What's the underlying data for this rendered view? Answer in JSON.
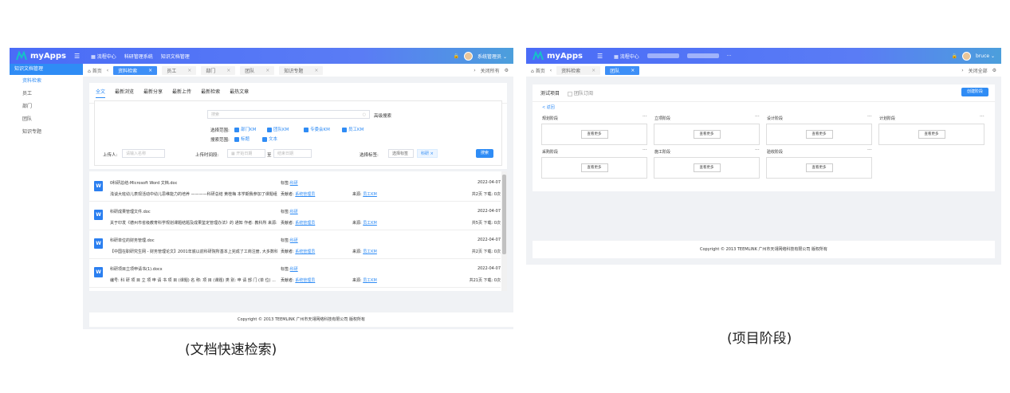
{
  "left": {
    "app_name": "myApps",
    "topnav": [
      "流程中心",
      "科研管理系统",
      "知识文档管理"
    ],
    "user": "系统管理员",
    "sidebar_title": "知识文档管理",
    "sidebar_items": [
      "资料检索",
      "员工",
      "部门",
      "团队",
      "知识专题"
    ],
    "tabs": [
      {
        "label": "首页"
      },
      {
        "label": "资料检索"
      },
      {
        "label": "员工"
      },
      {
        "label": "部门"
      },
      {
        "label": "团队"
      },
      {
        "label": "知识专题"
      }
    ],
    "close_all": "关闭所有",
    "subtabs": [
      "全文",
      "最新浏览",
      "最新分享",
      "最新上传",
      "最新检索",
      "最热文章"
    ],
    "search": {
      "placeholder": "搜索",
      "advanced": "高级搜索",
      "scope_label": "选择范围:",
      "scope_options": [
        "部门KM",
        "团队KM",
        "专委会KM",
        "员工KM"
      ],
      "type_label": "搜索范围:",
      "type_options": [
        "标题",
        "文本"
      ],
      "uploader_label": "上传人:",
      "uploader_placeholder": "请输入名称",
      "time_label": "上传时间段:",
      "start_placeholder": "开始日期",
      "to": "至",
      "end_placeholder": "结束日期",
      "tag_label": "选择标签:",
      "tag_select": "选择标签",
      "tag_chip": "科研",
      "search_button": "搜索"
    },
    "results": [
      {
        "title": "0科研总结-Microsoft Word 文档.doc",
        "tag_prefix": "标签:",
        "tag": "科研",
        "date": "2022-04-07",
        "desc": "浅谈大班幼儿表现活动中幼儿思维能力的培养 ————科研总结 黄桂梅 本学期我参加了课题组的学习...",
        "contributor_label": "贡献者:",
        "contributor": "系统管理员",
        "source_label": "来源:",
        "source": "员工KM",
        "stats": "共2页  下载:  0次"
      },
      {
        "title": "科研成果管理文件.doc",
        "tag_prefix": "标签:",
        "tag": "科研",
        "date": "2022-04-07",
        "desc": "关于印发《德州市省级教育科学规划课题结题及成果鉴定管理办法》的 通知 作者: 教科所 来源: 教科...",
        "contributor_label": "贡献者:",
        "contributor": "系统管理员",
        "source_label": "来源:",
        "source": "员工KM",
        "stats": "共5页  下载:  0次"
      },
      {
        "title": "科研单位的财务管理.doc",
        "tag_prefix": "标签:",
        "tag": "科研",
        "date": "2022-04-07",
        "desc": "【中国在职研究生网 - 财务管理论文】2001年底以前科研院所基本上完成了工商注册, 大多数科研院...",
        "contributor_label": "贡献者:",
        "contributor": "系统管理员",
        "source_label": "来源:",
        "source": "员工KM",
        "stats": "共2页  下载:  0次"
      },
      {
        "title": "科研项目立项申请书(1).docx",
        "tag_prefix": "标签:",
        "tag": "科研",
        "date": "2022-04-07",
        "desc": "编号: 科 研 项 目 立 项 申 请 书 项 目 (课题) 名 称: 项 目 (课题) 类 别: 申 请 部 门 (单 位) ...",
        "contributor_label": "贡献者:",
        "contributor": "系统管理员",
        "source_label": "来源:",
        "source": "员工KM",
        "stats": "共21页  下载:  0次"
      }
    ],
    "footer": "Copyright © 2013 TEEMLINK 广州市天翎网络科技有限公司 版权所有",
    "caption": "(文档快速检索)"
  },
  "right": {
    "app_name": "myApps",
    "topnav": [
      "流程中心"
    ],
    "user": "bruce",
    "tabs": [
      {
        "label": "首页"
      },
      {
        "label": "资料检索"
      },
      {
        "label": "团队"
      }
    ],
    "close_all": "关闭全部",
    "subtabs": [
      "测试项目",
      "团队订阅"
    ],
    "create_button": "创建阶段",
    "back": "< 返回",
    "stages_row1": [
      "规划阶段",
      "立项阶段",
      "设计阶段",
      "计划阶段"
    ],
    "stages_row2": [
      "采购阶段",
      "施工阶段",
      "验收阶段"
    ],
    "view_more": "查看更多",
    "dots": "···",
    "footer": "Copyright © 2013 TEEMLINK 广州市天翎网络科技有限公司 版权所有",
    "caption": "(项目阶段)"
  },
  "colors": {
    "brand": "#4a6cf7",
    "accent": "#2f8cf5",
    "logo": "#16c1c8"
  }
}
